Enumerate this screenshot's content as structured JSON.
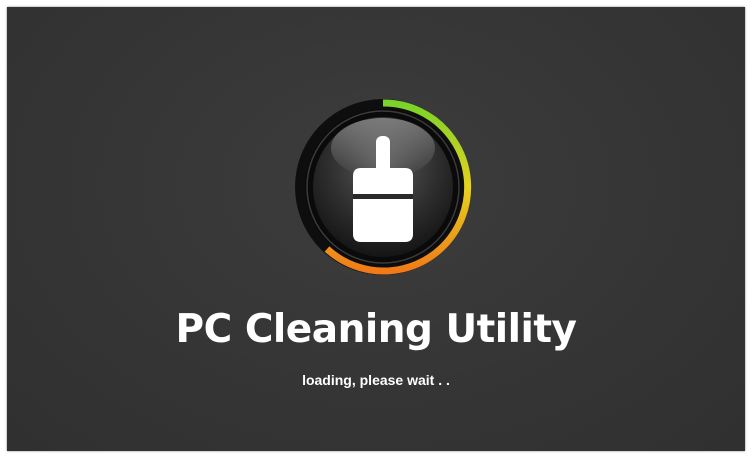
{
  "app": {
    "title": "PC Cleaning Utility",
    "status_text": "loading, please wait . .",
    "logo_icon": "brush-icon"
  },
  "colors": {
    "background": "#353535",
    "ring_green": "#7ad32a",
    "ring_yellow": "#e6d21e",
    "ring_orange": "#f07a18",
    "text": "#ffffff"
  }
}
